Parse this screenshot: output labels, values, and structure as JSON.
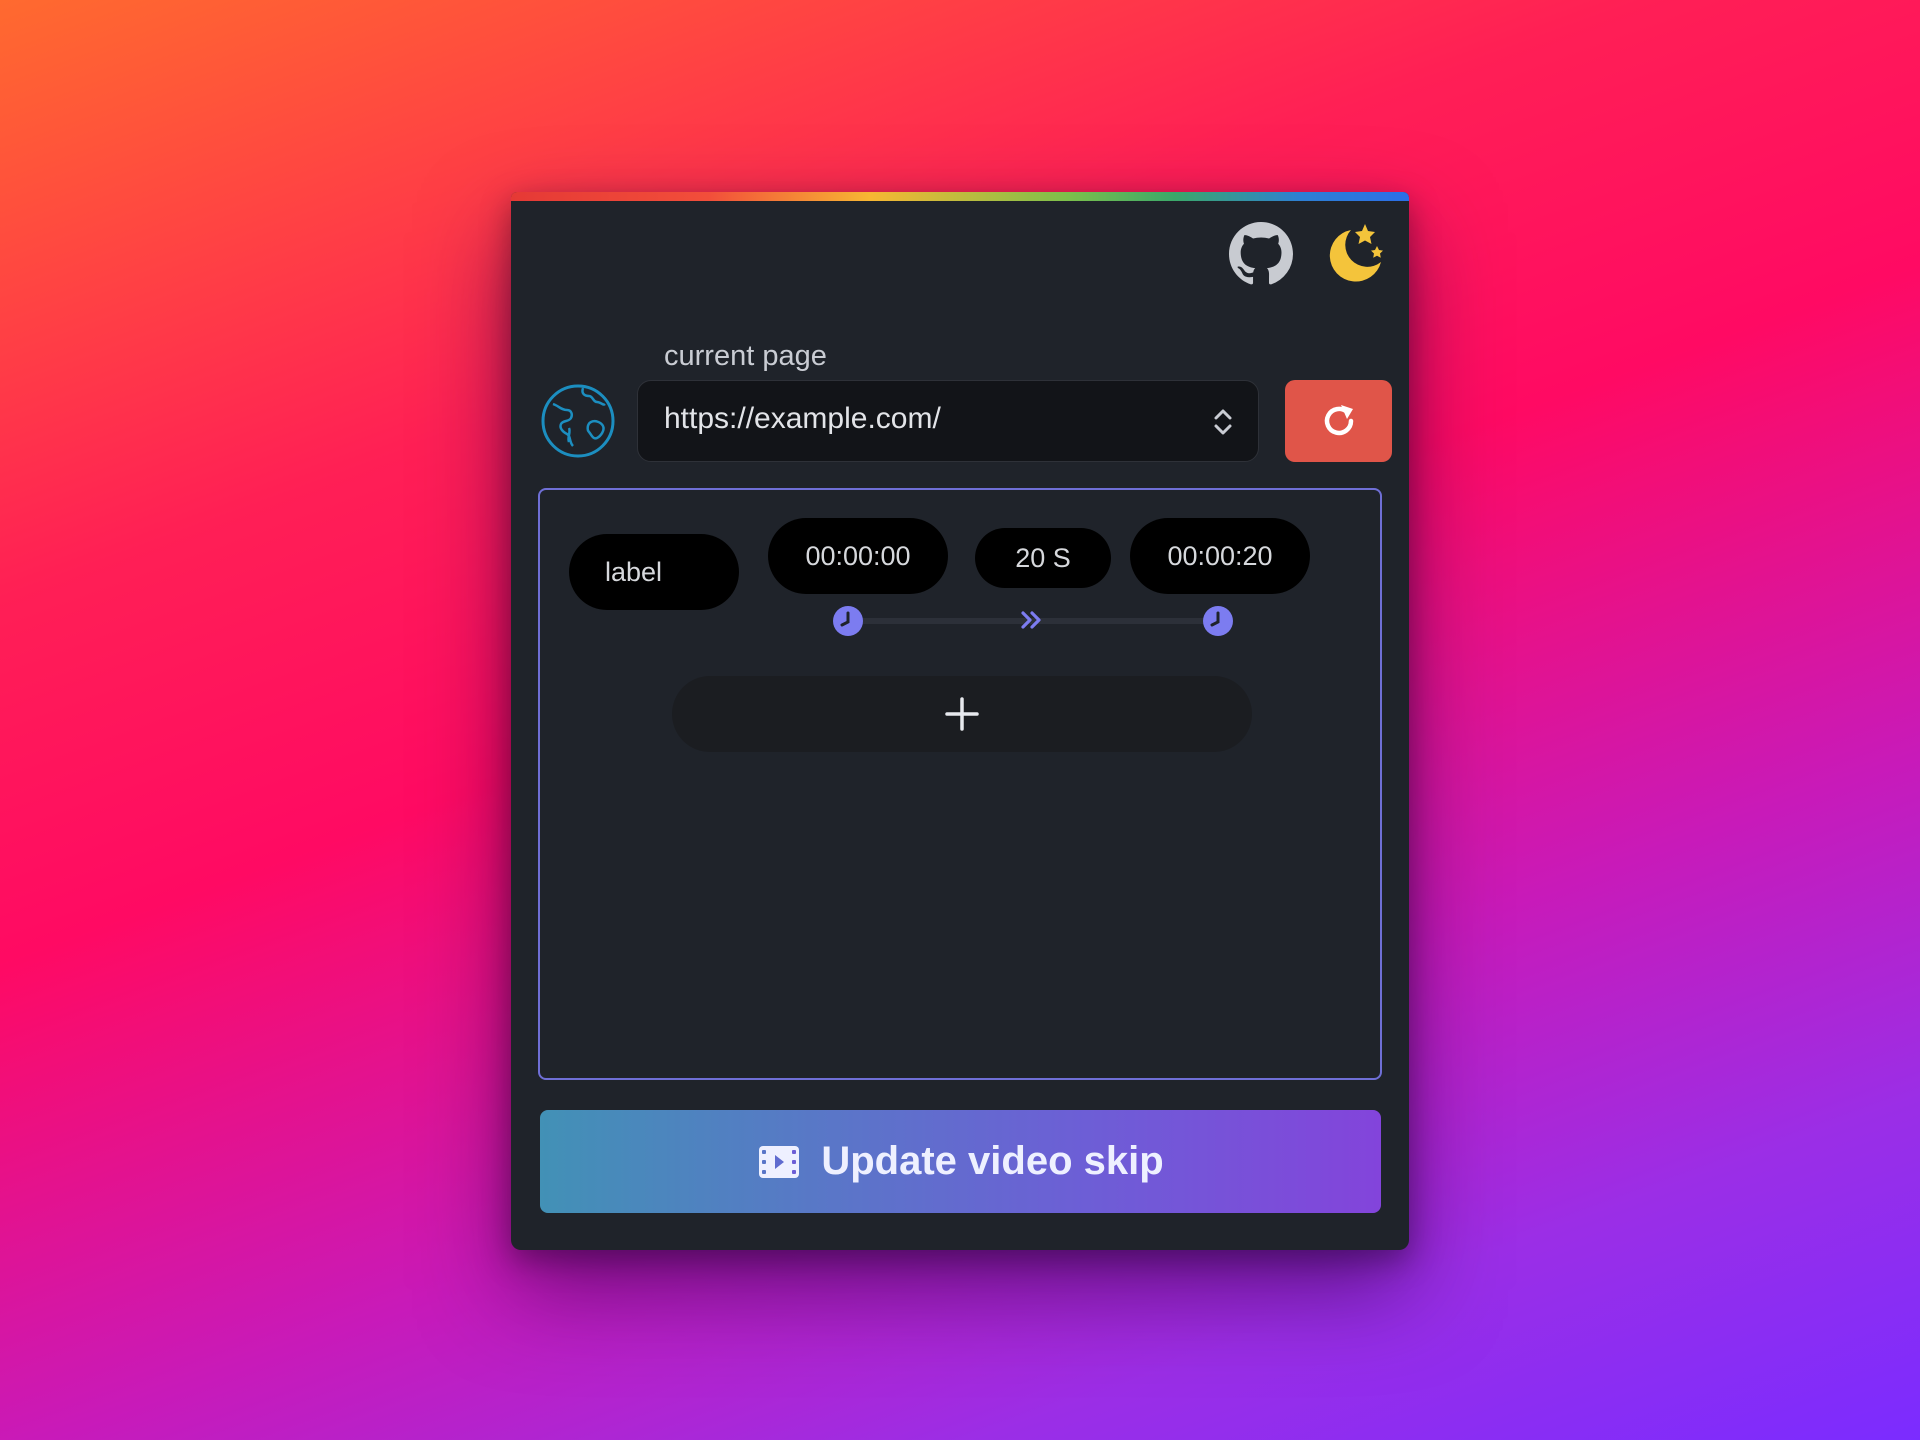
{
  "header": {
    "icons": [
      "github-icon",
      "moon-stars-icon"
    ],
    "accent_colors": {
      "moon": "#f4c43b",
      "github": "#c8cbd1"
    }
  },
  "page": {
    "label": "current page",
    "url": "https://example.com/",
    "globe_icon": "globe-icon",
    "refresh_icon": "refresh-icon",
    "refresh_color": "#e05549"
  },
  "skip": {
    "label_placeholder": "label",
    "start_time": "00:00:00",
    "duration": "20 S",
    "end_time": "00:00:20",
    "accent_color": "#6f6fd6",
    "add_icon": "plus-icon"
  },
  "actions": {
    "update_label": "Update video skip",
    "update_icon": "film-icon"
  }
}
